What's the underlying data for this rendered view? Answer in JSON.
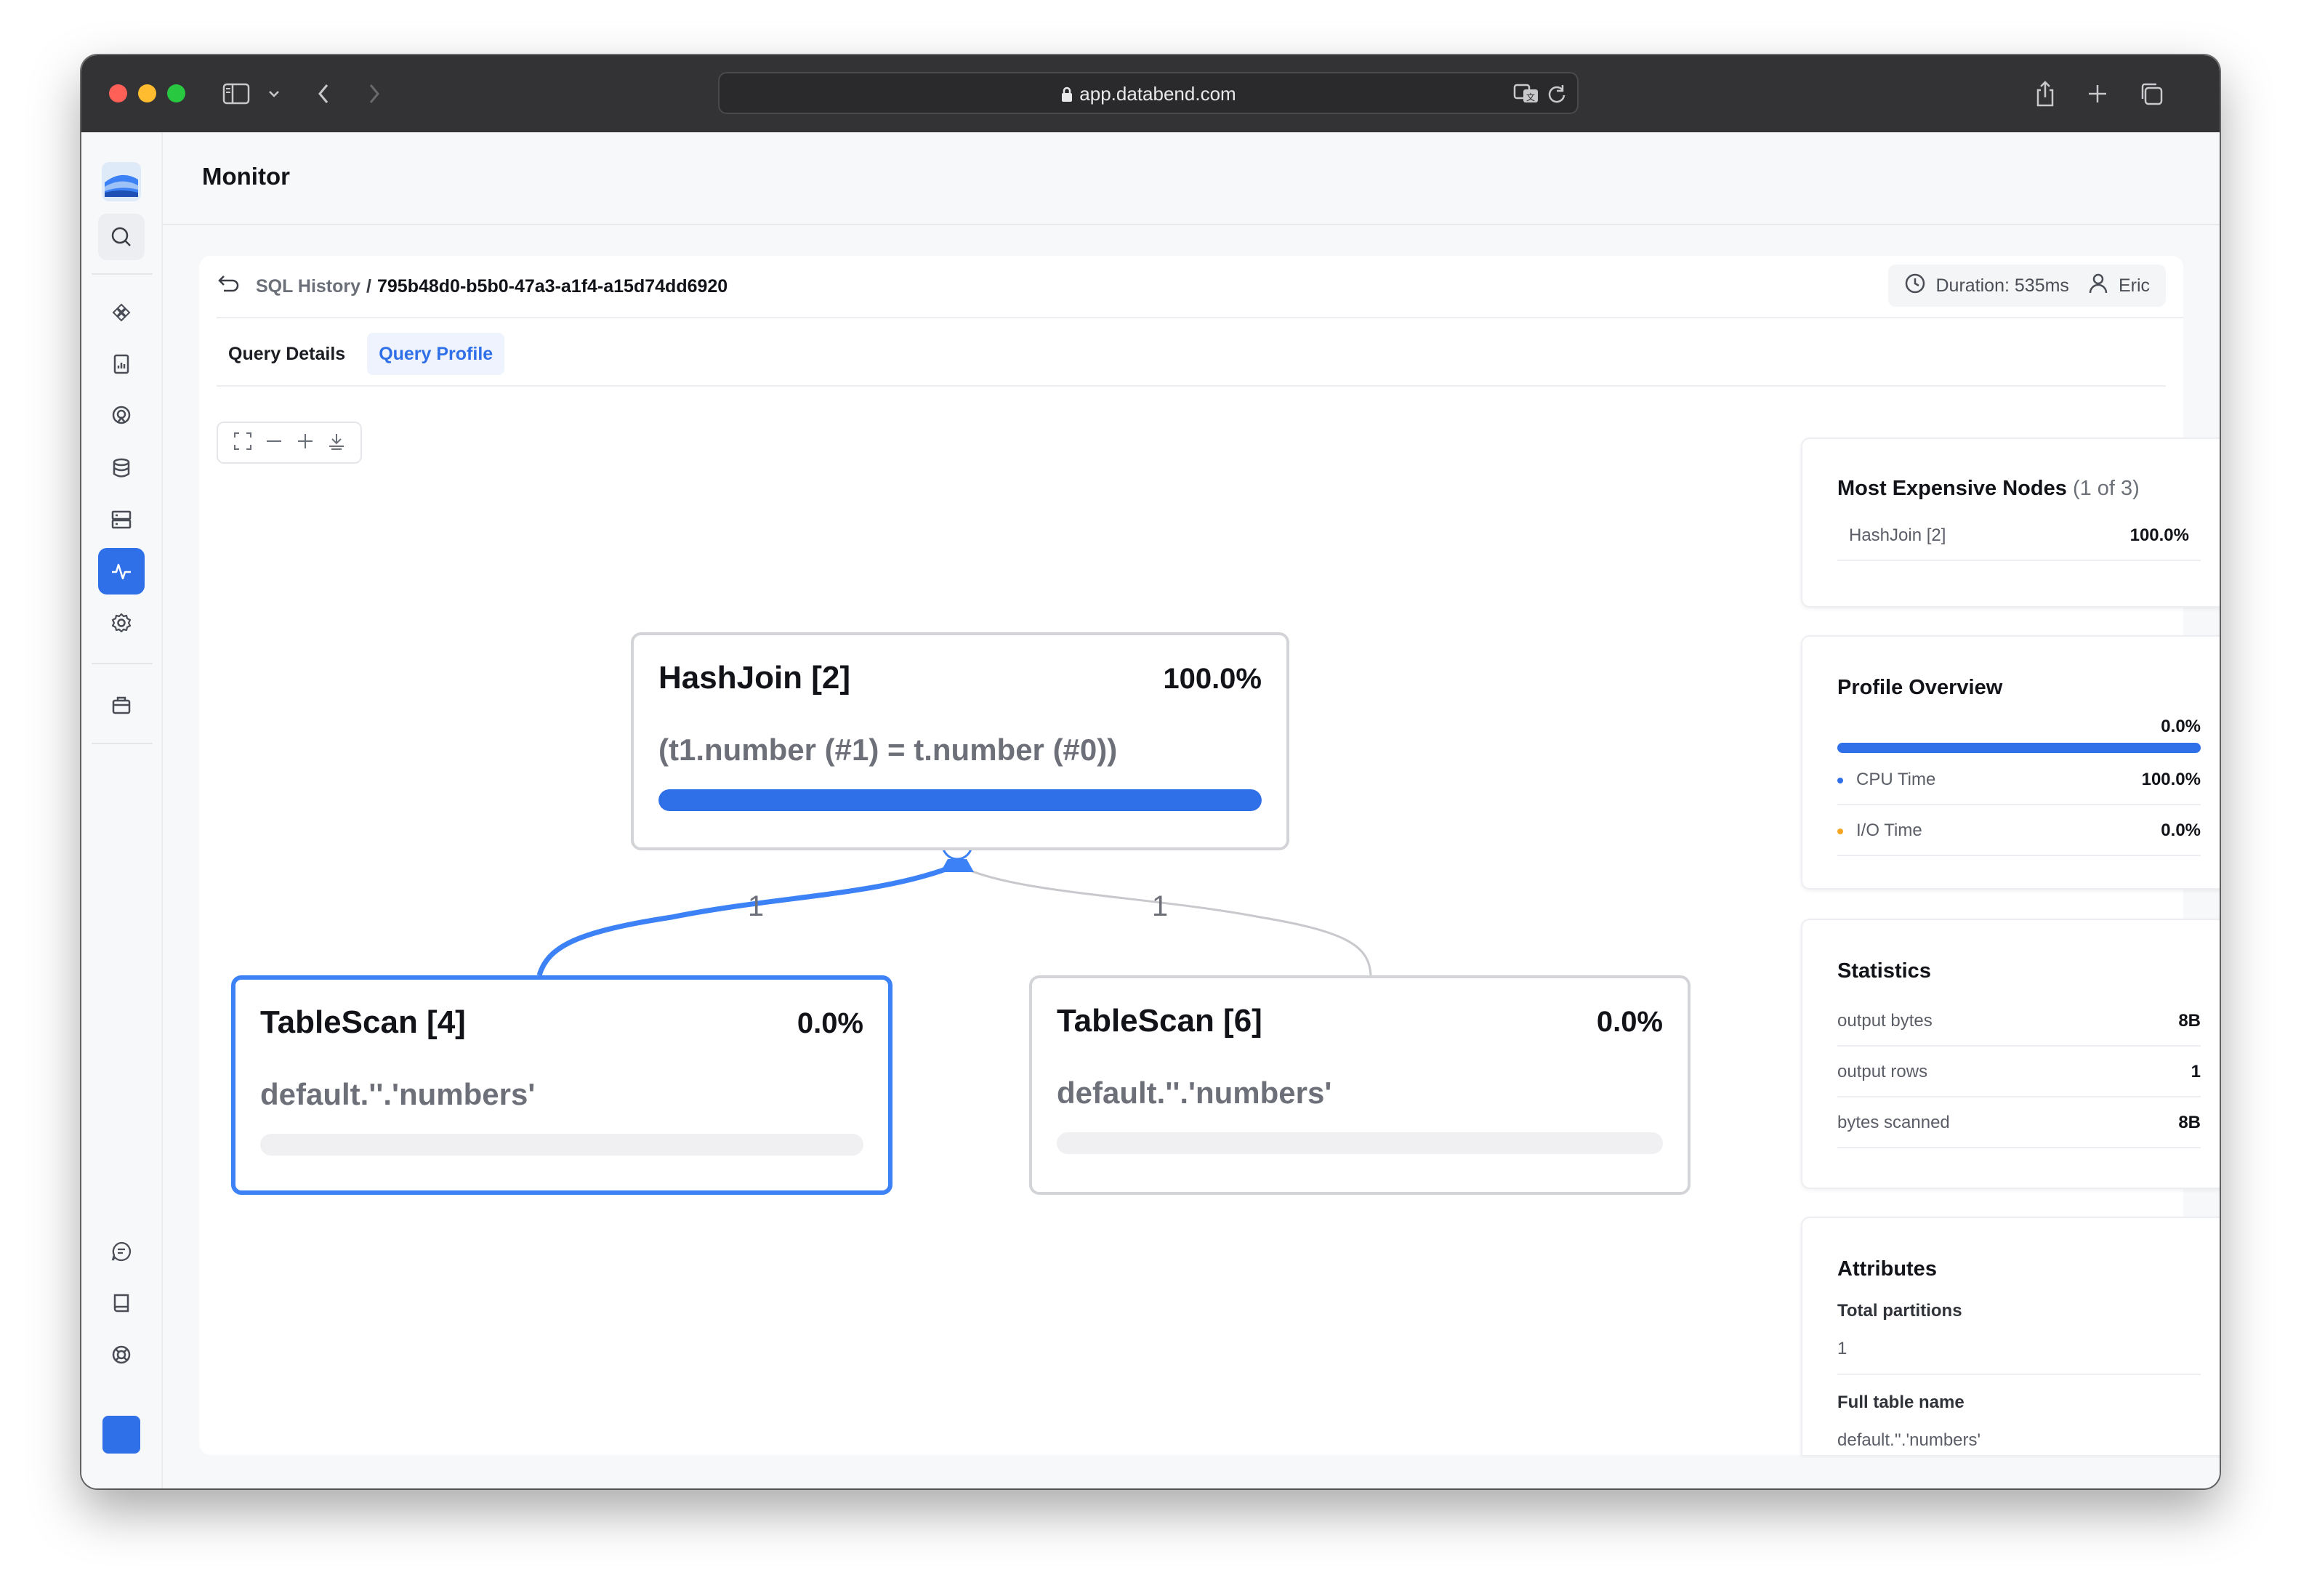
{
  "browser": {
    "url": "app.databend.com",
    "traffic_lights": {
      "close": "#fe5f57",
      "minimize": "#febc2e",
      "maximize": "#28c840"
    }
  },
  "colors": {
    "accent": "#2f6fe8",
    "node_selected_border": "#3c82f6",
    "io_bullet": "#f5a524"
  },
  "header": {
    "title": "Monitor"
  },
  "breadcrumb": {
    "parent": "SQL History",
    "separator": "/",
    "current": "795b48d0-b5b0-47a3-a1f4-a15d74dd6920"
  },
  "meta": {
    "duration": "Duration: 535ms",
    "user": "Eric"
  },
  "tabs": [
    {
      "label": "Query Details",
      "active": false
    },
    {
      "label": "Query Profile",
      "active": true
    }
  ],
  "graph": {
    "nodes": [
      {
        "title": "HashJoin [2]",
        "percent": "100.0%",
        "desc": "(t1.number (#1) = t.number (#0))",
        "fill": 1.0
      },
      {
        "title": "TableScan [4]",
        "percent": "0.0%",
        "desc": "default.''.'numbers'",
        "fill": 0.0,
        "selected": true
      },
      {
        "title": "TableScan [6]",
        "percent": "0.0%",
        "desc": "default.''.'numbers'",
        "fill": 0.0
      }
    ],
    "edges": [
      {
        "label": "1",
        "from": "HashJoin [2]",
        "to": "TableScan [4]"
      },
      {
        "label": "1",
        "from": "HashJoin [2]",
        "to": "TableScan [6]"
      }
    ]
  },
  "expensive": {
    "title": "Most Expensive Nodes",
    "count": "(1 of 3)",
    "rows": [
      {
        "name": "HashJoin [2]",
        "value": "100.0%"
      }
    ]
  },
  "overview": {
    "title": "Profile Overview",
    "bar_label": "0.0%",
    "rows": [
      {
        "name": "CPU Time",
        "value": "100.0%"
      },
      {
        "name": "I/O Time",
        "value": "0.0%"
      }
    ]
  },
  "statistics": {
    "title": "Statistics",
    "rows": [
      {
        "name": "output bytes",
        "value": "8B"
      },
      {
        "name": "output rows",
        "value": "1"
      },
      {
        "name": "bytes scanned",
        "value": "8B"
      }
    ]
  },
  "attributes": {
    "title": "Attributes",
    "items": [
      {
        "label": "Total partitions",
        "value": "1"
      },
      {
        "label": "Full table name",
        "value": "default.''.'numbers'"
      }
    ]
  }
}
